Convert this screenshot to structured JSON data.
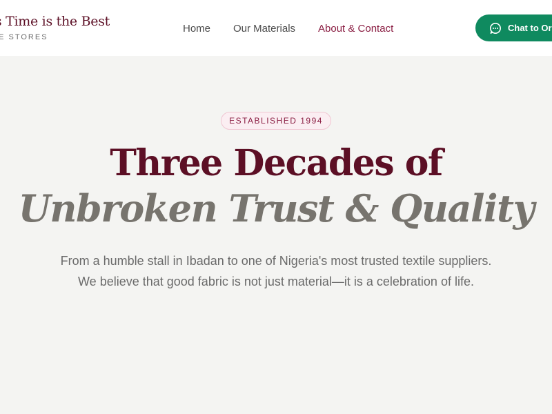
{
  "header": {
    "brand_title": "'s Time is the Best",
    "brand_subtitle": "LE STORES",
    "nav": [
      {
        "label": "Home",
        "active": false
      },
      {
        "label": "Our Materials",
        "active": false
      },
      {
        "label": "About & Contact",
        "active": true
      }
    ],
    "cta_label": "Chat to Ord",
    "cta_icon": "chat-bubble-icon"
  },
  "hero": {
    "badge": "ESTABLISHED 1994",
    "headline_line1": "Three Decades of",
    "headline_line2": "Unbroken Trust & Quality",
    "lead_line1": "From a humble stall in Ibadan to one of Nigeria's most trusted textile suppliers.",
    "lead_line2": "We believe that good fabric is not just material—it is a celebration of life."
  },
  "colors": {
    "brand_maroon": "#5c0f25",
    "nav_active": "#8a1d42",
    "cta_green": "#0f8a5f",
    "page_background": "#f4f4f2"
  }
}
